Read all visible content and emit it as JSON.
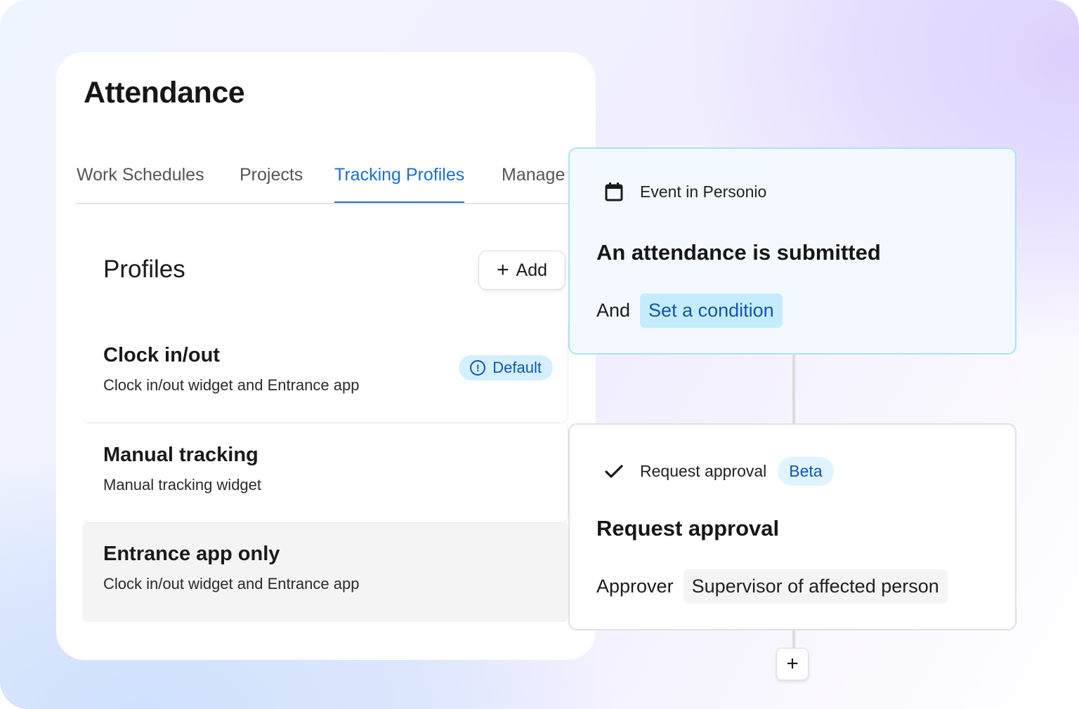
{
  "page": {
    "title": "Attendance",
    "tabs": [
      {
        "label": "Work Schedules",
        "active": false
      },
      {
        "label": "Projects",
        "active": false
      },
      {
        "label": "Tracking Profiles",
        "active": true
      },
      {
        "label": "Manage",
        "active": false
      }
    ]
  },
  "profiles": {
    "title": "Profiles",
    "add_label": "Add",
    "items": [
      {
        "name": "Clock in/out",
        "description": "Clock in/out widget and Entrance app",
        "badge": "Default"
      },
      {
        "name": "Manual tracking",
        "description": "Manual tracking widget"
      },
      {
        "name": "Entrance app only",
        "description": "Clock in/out widget and Entrance app"
      }
    ]
  },
  "workflow": {
    "trigger": {
      "icon": "calendar-icon",
      "kind": "Event in Personio",
      "title": "An attendance is submitted",
      "and_label": "And",
      "condition_label": "Set a condition"
    },
    "action": {
      "icon": "check-icon",
      "kind": "Request approval",
      "badge": "Beta",
      "title": "Request approval",
      "approver_label": "Approver",
      "approver_value": "Supervisor of affected person"
    },
    "add_step_label": "+"
  },
  "colors": {
    "accent": "#1a6fd0",
    "badge_bg": "#d4efff",
    "badge_text": "#0e57a8",
    "trigger_border": "#a9e3f7",
    "trigger_bg": "#f4f9ff"
  }
}
